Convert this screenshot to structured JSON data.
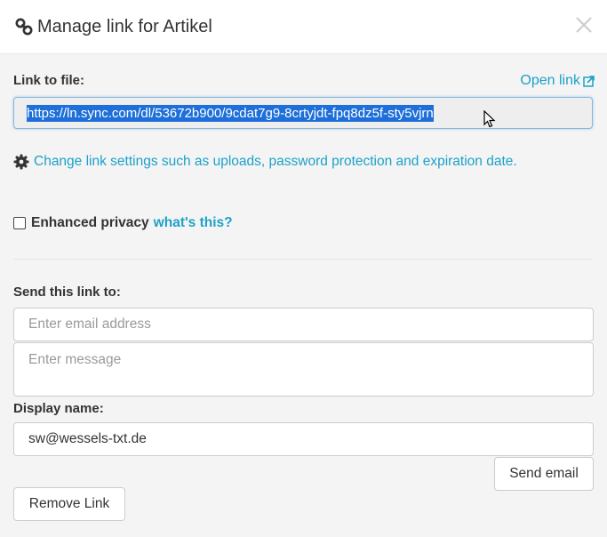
{
  "header": {
    "title": "Manage link for Artikel",
    "icons": {
      "link": "link-icon",
      "close": "close-icon"
    }
  },
  "link_section": {
    "label": "Link to file:",
    "open_link_label": "Open link",
    "url": "https://ln.sync.com/dl/53672b900/9cdat7g9-8crtyjdt-fpq8dz5f-sty5vjrn"
  },
  "settings": {
    "text": "Change link settings such as uploads, password protection and expiration date."
  },
  "privacy": {
    "label": "Enhanced privacy",
    "help_link": "what's this?",
    "checked": false
  },
  "send": {
    "label": "Send this link to:",
    "email_placeholder": "Enter email address",
    "message_placeholder": "Enter message",
    "display_name_label": "Display name:",
    "display_name_value": "sw@wessels-txt.de",
    "send_button": "Send email"
  },
  "remove_button": "Remove Link",
  "colors": {
    "accent": "#1da1c8",
    "selection": "#1e6fd9",
    "background": "#f4f4f4"
  }
}
